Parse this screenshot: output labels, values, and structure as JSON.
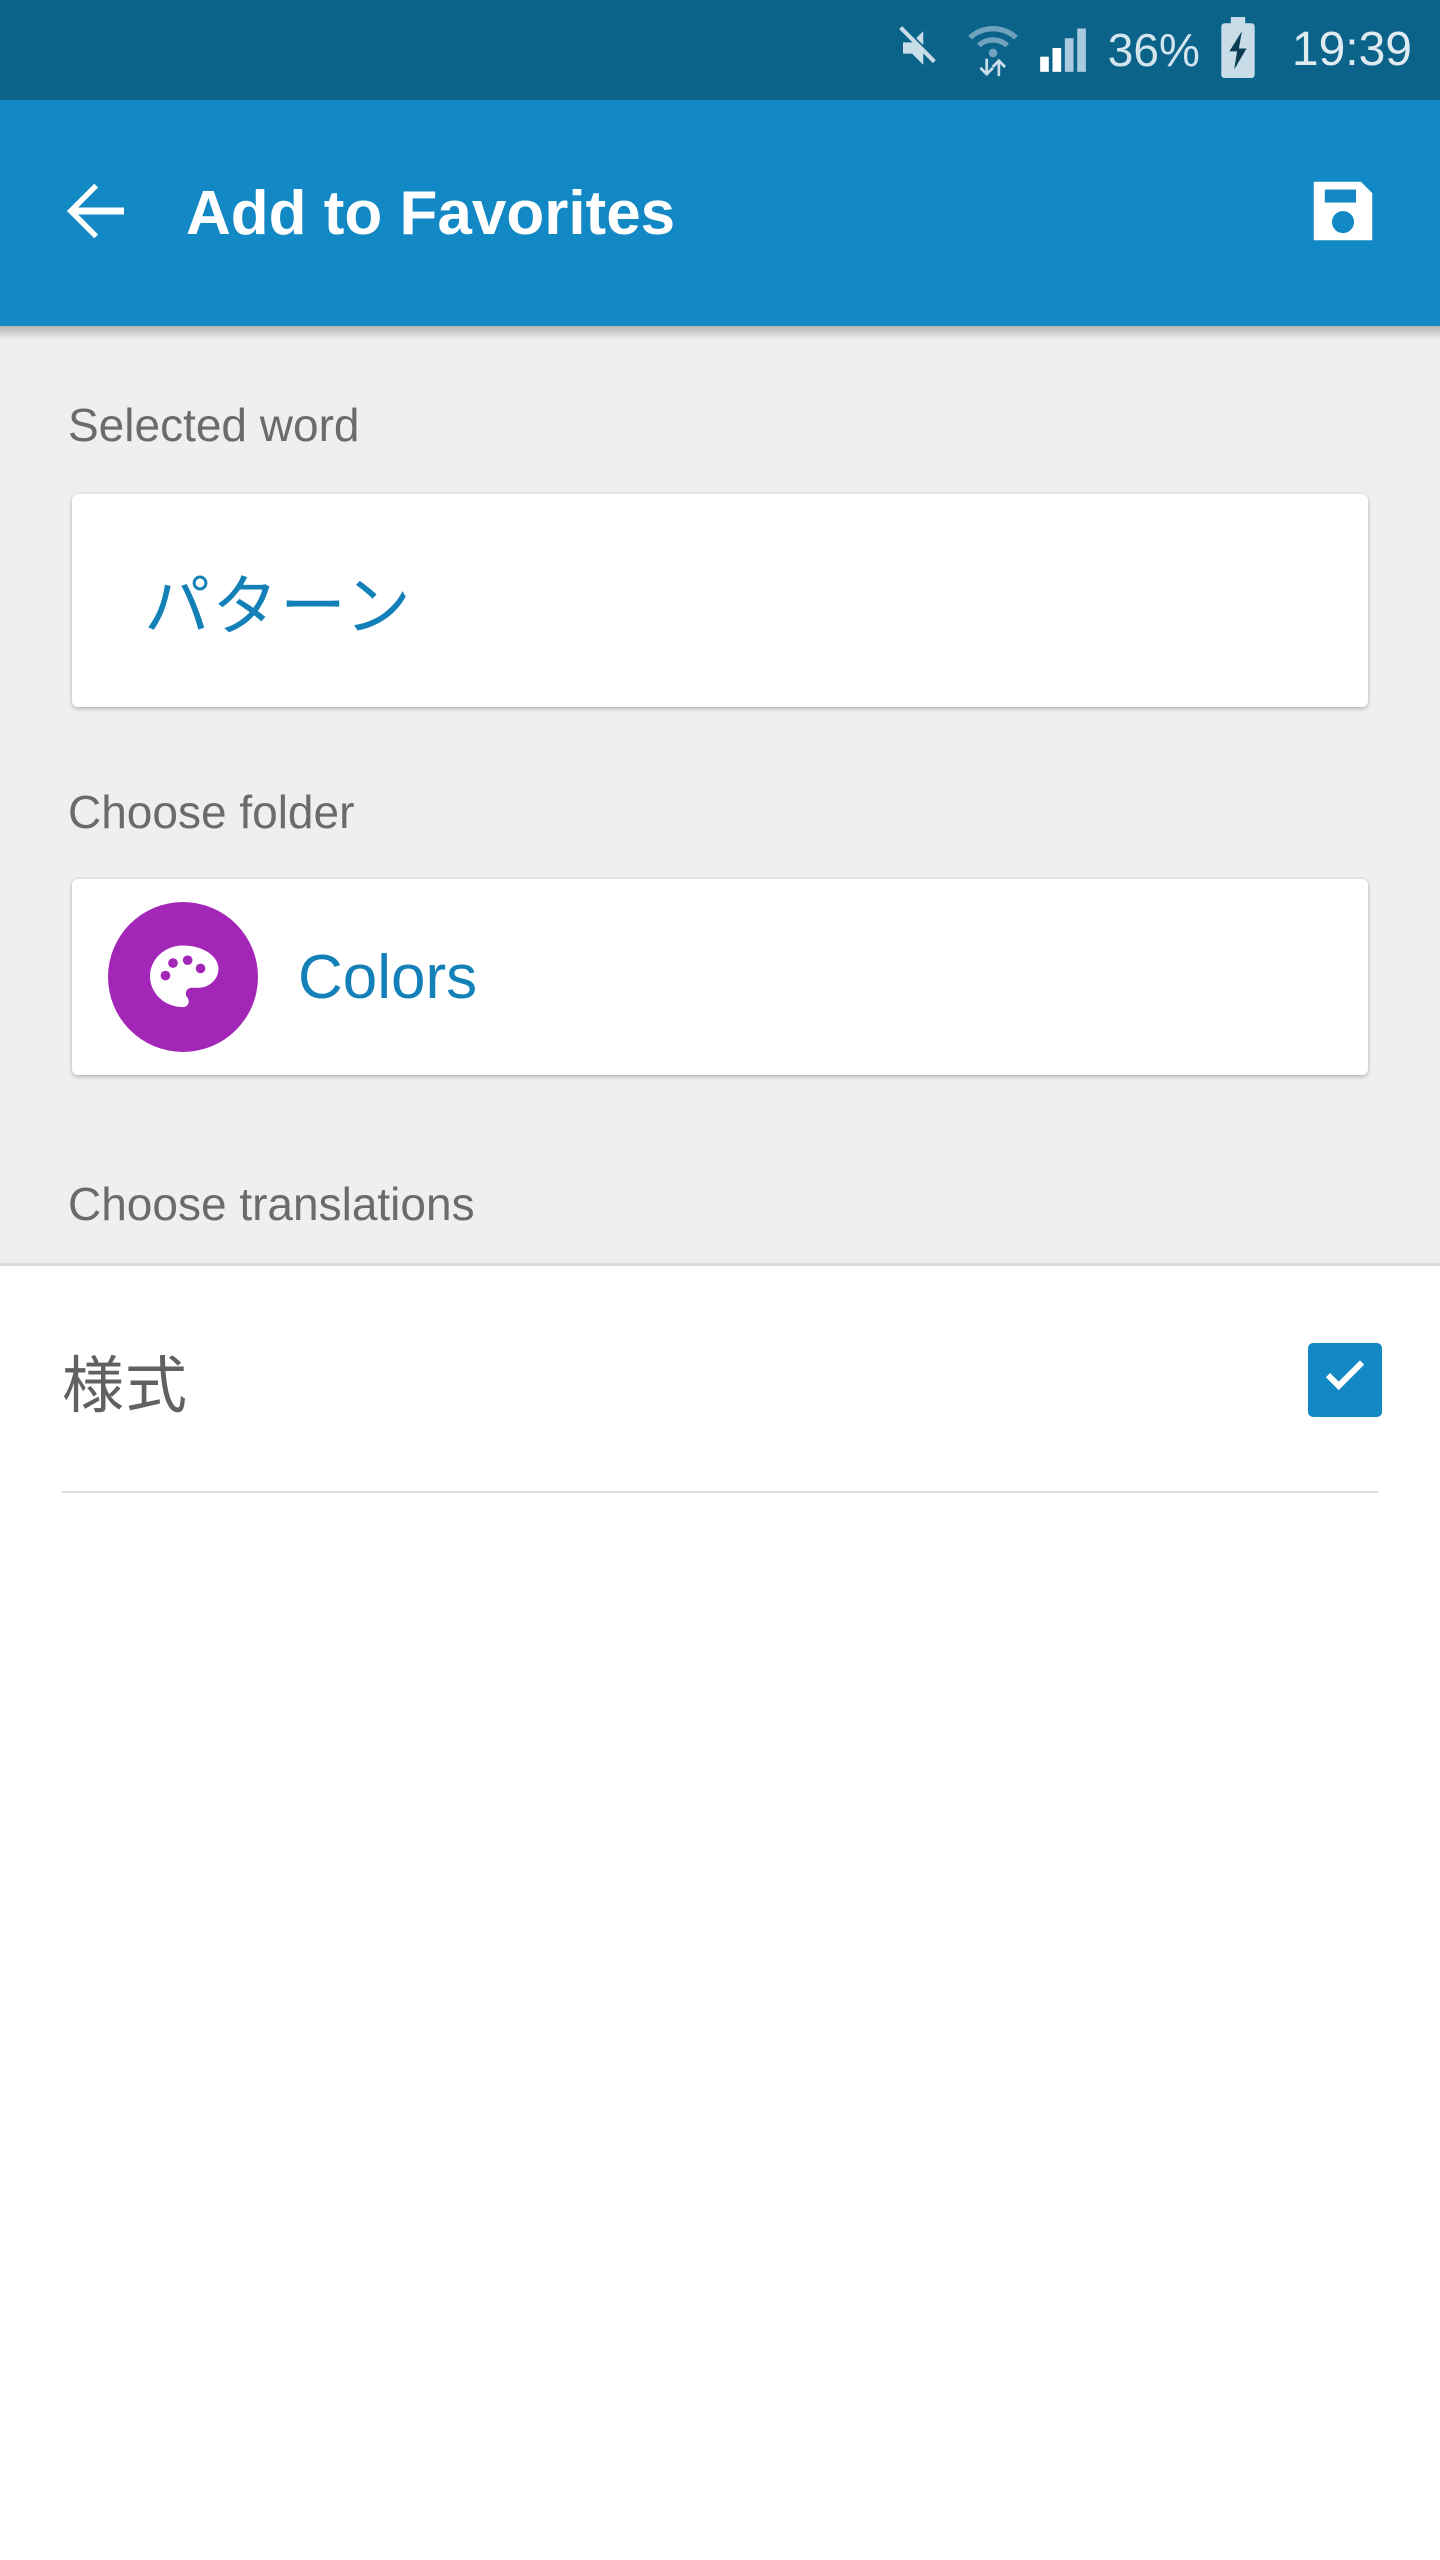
{
  "status_bar": {
    "background": "#0b638a",
    "battery_percent": "36%",
    "clock": "19:39",
    "icons": [
      "mute-icon",
      "wifi-icon",
      "signal-icon",
      "battery-charging-icon"
    ]
  },
  "app_bar": {
    "background": "#1289c4",
    "title": "Add to Favorites",
    "back_icon": "arrow-left-icon",
    "save_icon": "save-floppy-icon"
  },
  "form": {
    "selected_word": {
      "label": "Selected word",
      "value": "パターン",
      "value_color": "#1380b8"
    },
    "choose_folder": {
      "label": "Choose folder",
      "folder_name": "Colors",
      "folder_icon": "palette-icon",
      "folder_icon_color": "#a327b7",
      "folder_name_color": "#1380b8"
    },
    "choose_translations": {
      "label": "Choose translations",
      "items": [
        {
          "text": "様式",
          "checked": true
        }
      ]
    }
  }
}
